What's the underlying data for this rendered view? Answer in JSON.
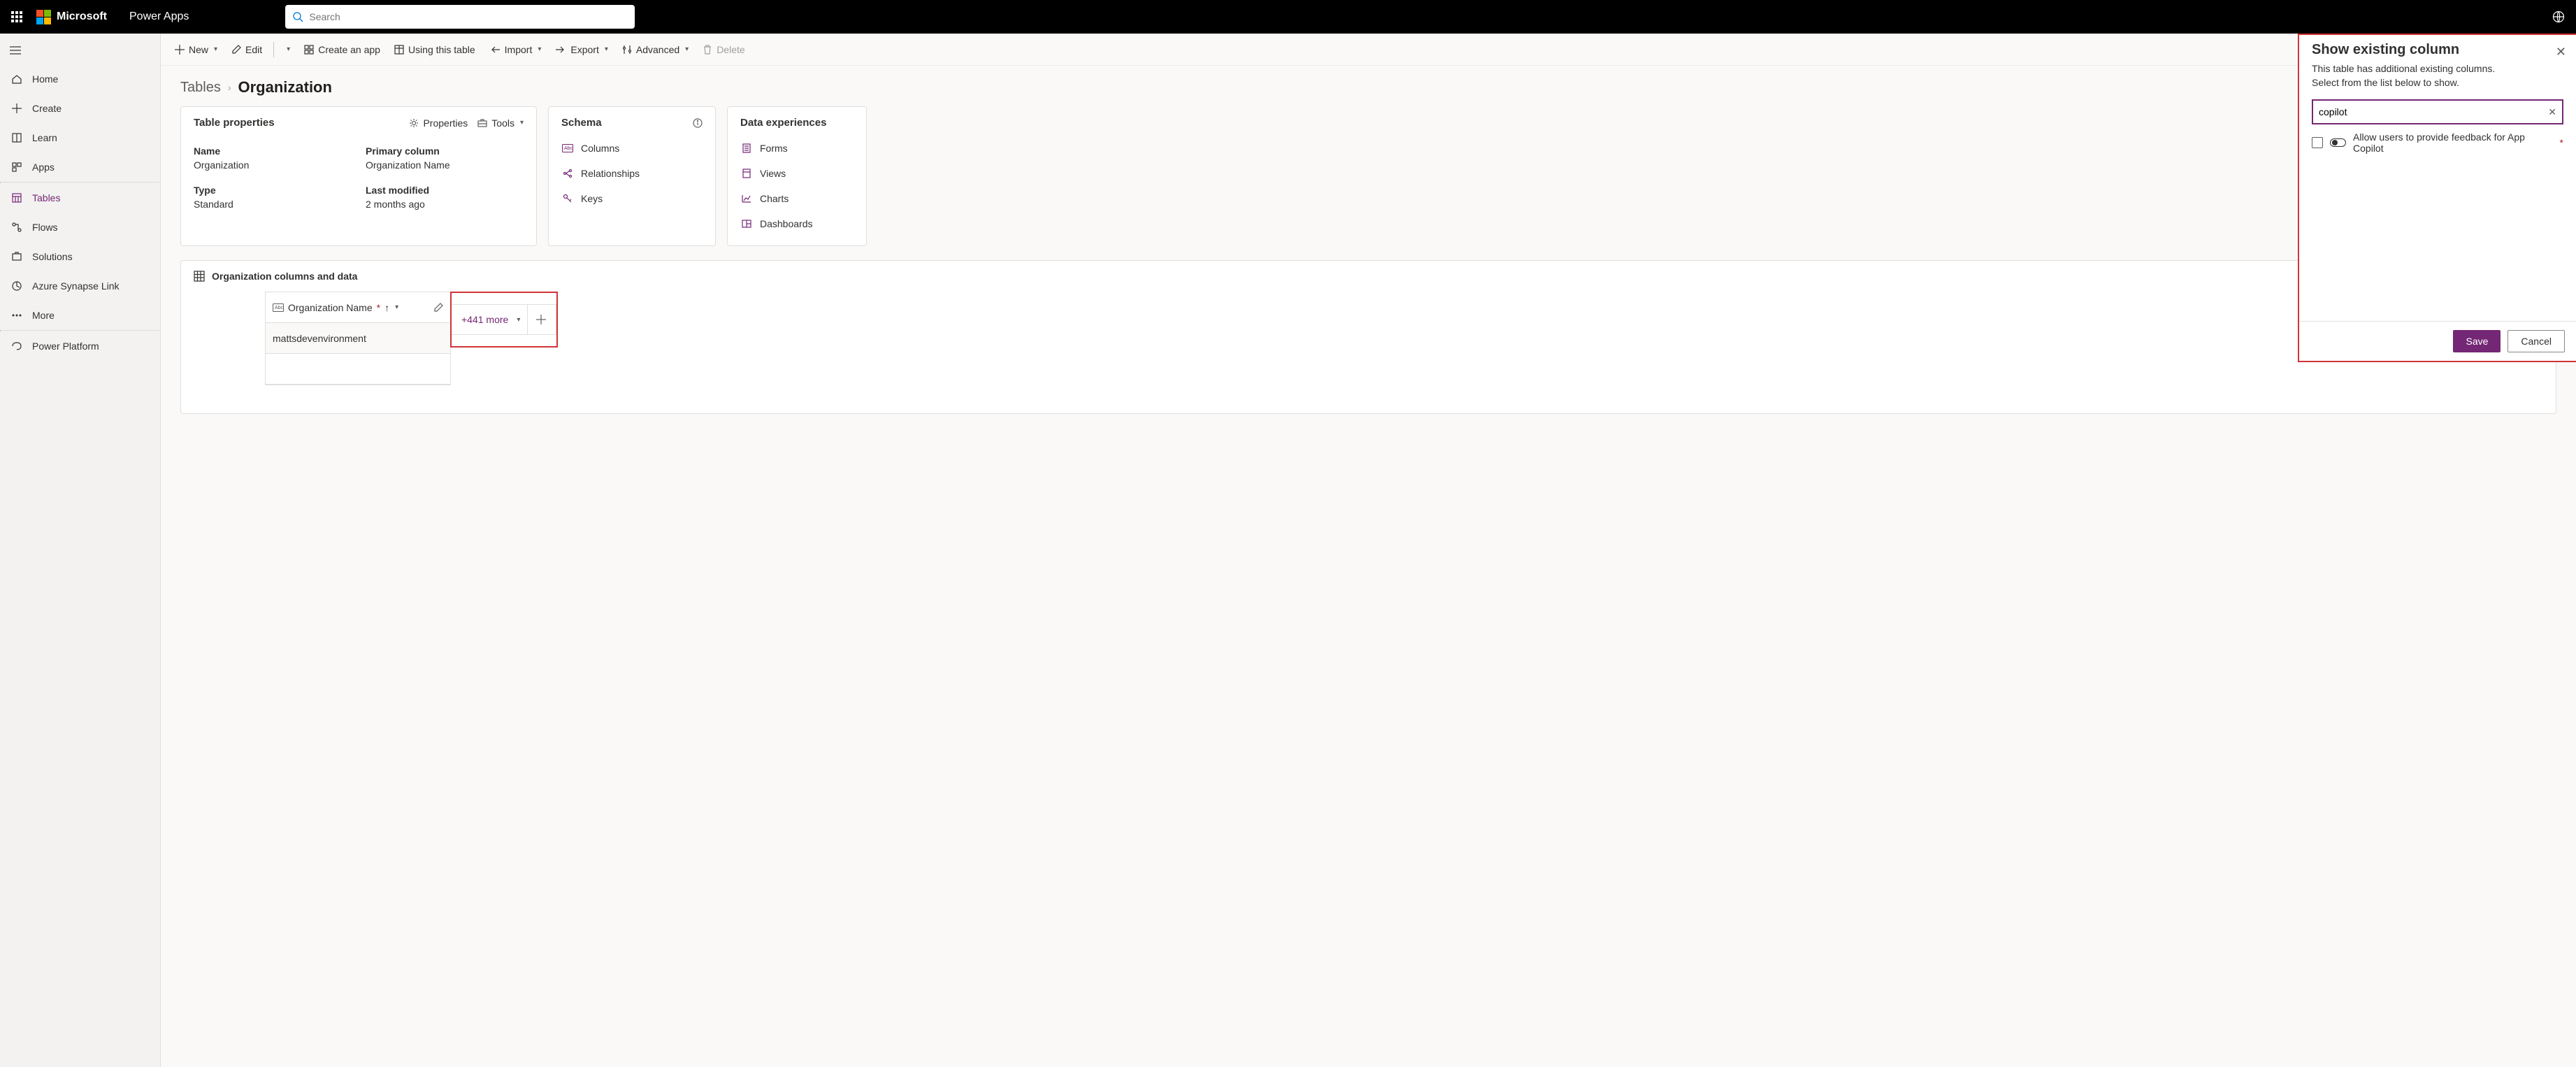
{
  "header": {
    "brand": "Microsoft",
    "app_name": "Power Apps",
    "search_placeholder": "Search"
  },
  "sidebar": {
    "items": [
      {
        "label": "Home"
      },
      {
        "label": "Create"
      },
      {
        "label": "Learn"
      },
      {
        "label": "Apps"
      },
      {
        "label": "Tables"
      },
      {
        "label": "Flows"
      },
      {
        "label": "Solutions"
      },
      {
        "label": "Azure Synapse Link"
      },
      {
        "label": "More"
      },
      {
        "label": "Power Platform"
      }
    ]
  },
  "cmdbar": {
    "new": "New",
    "edit": "Edit",
    "create_app": "Create an app",
    "using_table": "Using this table",
    "import": "Import",
    "export": "Export",
    "advanced": "Advanced",
    "delete": "Delete"
  },
  "breadcrumb": {
    "root": "Tables",
    "current": "Organization"
  },
  "props": {
    "title": "Table properties",
    "properties_btn": "Properties",
    "tools_btn": "Tools",
    "name_k": "Name",
    "name_v": "Organization",
    "primary_k": "Primary column",
    "primary_v": "Organization Name",
    "type_k": "Type",
    "type_v": "Standard",
    "modified_k": "Last modified",
    "modified_v": "2 months ago"
  },
  "schema": {
    "title": "Schema",
    "columns": "Columns",
    "relationships": "Relationships",
    "keys": "Keys"
  },
  "dx": {
    "title": "Data experiences",
    "forms": "Forms",
    "views": "Views",
    "charts": "Charts",
    "dashboards": "Dashboards"
  },
  "section2": {
    "title": "Organization columns and data",
    "col_header": "Organization Name",
    "row0": "mattsdevenvironment",
    "more": "+441 more"
  },
  "panel": {
    "title": "Show existing column",
    "sub1": "This table has additional existing columns.",
    "sub2": "Select from the list below to show.",
    "search_value": "copilot",
    "result": "Allow users to provide feedback for App Copilot",
    "save": "Save",
    "cancel": "Cancel"
  }
}
